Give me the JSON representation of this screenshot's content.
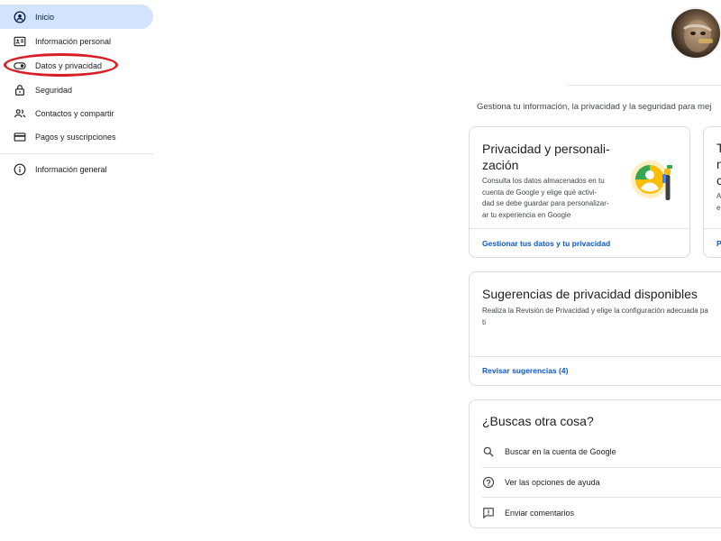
{
  "sidebar": {
    "items": [
      {
        "label": "Inicio",
        "icon": "account-circle-icon"
      },
      {
        "label": "Información personal",
        "icon": "id-card-icon"
      },
      {
        "label": "Datos y privacidad",
        "icon": "toggle-icon"
      },
      {
        "label": "Seguridad",
        "icon": "lock-icon"
      },
      {
        "label": "Contactos y compartir",
        "icon": "people-icon"
      },
      {
        "label": "Pagos y suscripciones",
        "icon": "credit-card-icon"
      }
    ],
    "footer_item": {
      "label": "Información general",
      "icon": "info-icon"
    }
  },
  "main": {
    "intro": "Gestiona tu información, la privacidad y la seguridad para mej",
    "privacy_card": {
      "title_line1": "Privacidad y personali-",
      "title_line2": "zación",
      "desc_lines": [
        "Consulta los datos almacenados en tu",
        "cuenta de Google y elige qué activi-",
        "dad se debe guardar para personalizar-",
        "ar tu experiencia en Google"
      ],
      "link": "Gestionar tus datos y tu privacidad"
    },
    "peek_card": {
      "letters": [
        "T",
        "n",
        "c"
      ],
      "small": [
        "A",
        "e"
      ],
      "link": "P"
    },
    "suggestions_card": {
      "title": "Sugerencias de privacidad disponibles",
      "desc_line1": "Realiza la Revisión de Privacidad y elige la configuración adecuada pa",
      "desc_line2": "ti",
      "link": "Revisar sugerencias (4)"
    },
    "other_card": {
      "title": "¿Buscas otra cosa?",
      "rows": [
        {
          "label": "Buscar en la cuenta de Google",
          "icon": "search-icon"
        },
        {
          "label": "Ver las opciones de ayuda",
          "icon": "help-icon"
        },
        {
          "label": "Enviar comentarios",
          "icon": "feedback-icon"
        }
      ]
    }
  },
  "colors": {
    "active_nav_bg": "#d3e3fd",
    "link": "#0b57d0",
    "highlight": "#d81f26"
  }
}
